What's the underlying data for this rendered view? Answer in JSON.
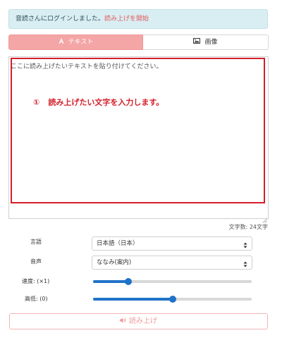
{
  "alert": {
    "message": "音読さんにログインしました。",
    "link": "読み上げを開始"
  },
  "tabs": [
    {
      "label": "テキスト",
      "icon": "font-icon",
      "active": true
    },
    {
      "label": "画像",
      "icon": "image-icon",
      "active": false
    }
  ],
  "textarea": {
    "placeholder": "ここに読み上げたいテキストを貼り付けてください。"
  },
  "annotation": {
    "number": "①",
    "text": "読み上げたい文字を入力します。",
    "color": "#d31f29"
  },
  "char_count": "文字数: 24文字",
  "settings": {
    "language": {
      "label": "言語",
      "value": "日本語（日本）"
    },
    "voice": {
      "label": "音声",
      "value": "ななみ(案内)"
    },
    "speed": {
      "label": "速度: (×1)",
      "level": 0.22
    },
    "pitch": {
      "label": "高低: (0)",
      "level": 0.5
    }
  },
  "speak_button": {
    "label": "読み上げ",
    "icon": "speaker-icon"
  },
  "colors": {
    "accent": "#f4a5a5",
    "slider": "#1f72c9",
    "alert_bg": "#d9eef3"
  }
}
